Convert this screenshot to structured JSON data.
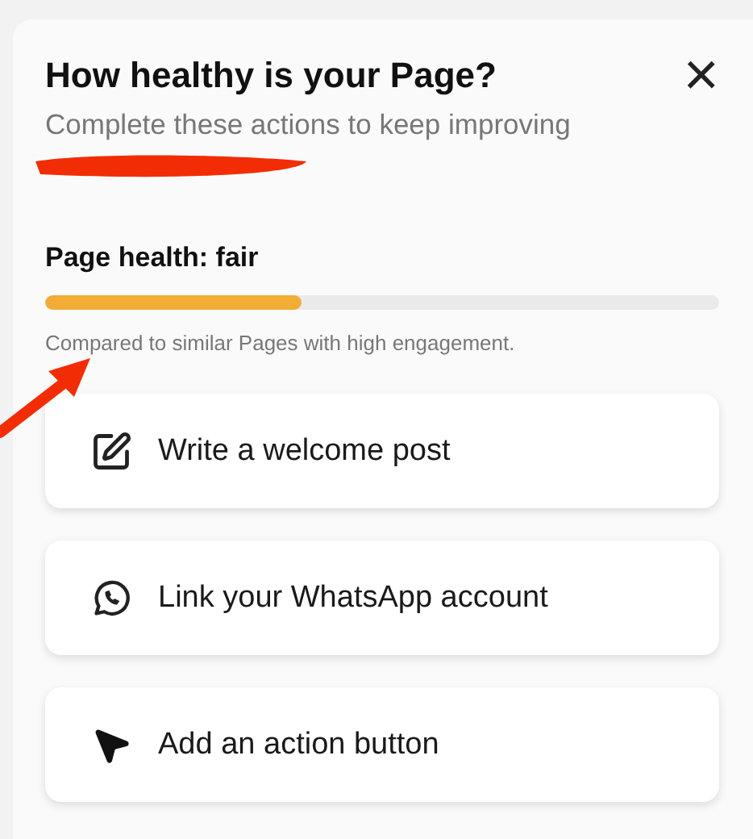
{
  "dialog": {
    "title": "How healthy is your Page?",
    "close": "×",
    "subtitle": "Complete these actions to keep improving"
  },
  "health": {
    "label": "Page health: fair",
    "level": 0.38,
    "caption": "Compared to similar Pages with high engagement."
  },
  "actions": [
    {
      "kind": "edit",
      "label": "Write a welcome post"
    },
    {
      "kind": "chat",
      "label": "Link your WhatsApp account"
    },
    {
      "kind": "pointer",
      "label": "Add an action button"
    }
  ]
}
